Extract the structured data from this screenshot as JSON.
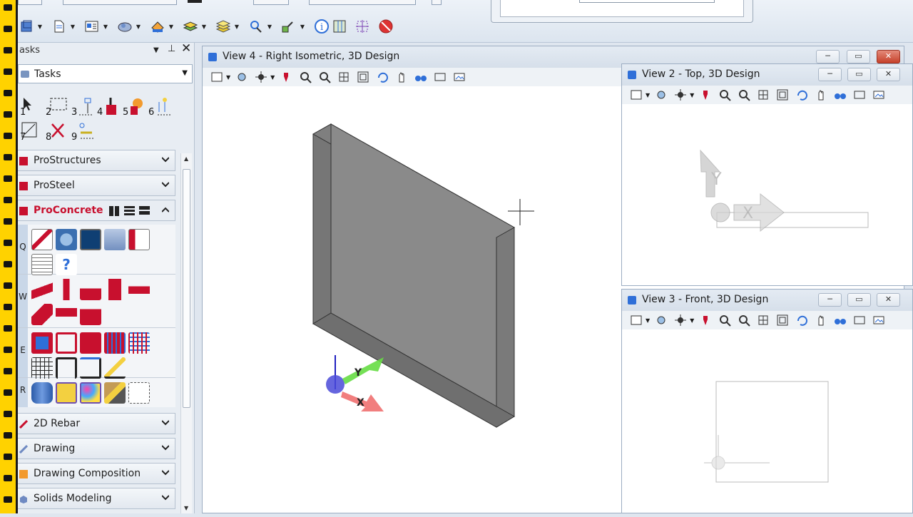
{
  "task_panel": {
    "title": "asks",
    "task_selector": "Tasks",
    "main_tool_numbers": [
      "1",
      "2",
      "3",
      "4",
      "5",
      "6",
      "7",
      "8",
      "9"
    ],
    "sections": [
      {
        "label": "ProStructures"
      },
      {
        "label": "ProSteel"
      },
      {
        "label": "ProConcrete"
      },
      {
        "label": "2D Rebar"
      },
      {
        "label": "Drawing"
      },
      {
        "label": "Drawing Composition"
      },
      {
        "label": "Solids Modeling"
      }
    ],
    "proconcrete_groups": [
      {
        "letter": "Q"
      },
      {
        "letter": "W"
      },
      {
        "letter": "E"
      },
      {
        "letter": "R"
      }
    ]
  },
  "views": {
    "view4": {
      "title": "View 4 - Right Isometric, 3D Design"
    },
    "view2": {
      "title": "View 2 - Top, 3D Design"
    },
    "view3": {
      "title": "View 3 - Front, 3D Design"
    }
  },
  "axis_labels": {
    "x": "X",
    "y": "Y"
  },
  "colors": {
    "accent_red": "#c8102e",
    "view_icon_blue": "#2f6fd8",
    "solid_fill": "#8a8a8a",
    "axis_x": "#f07070",
    "axis_y": "#7ad64a",
    "axis_z": "#4040d8"
  },
  "icons": {
    "toolbar": [
      "view-icon",
      "file-icon",
      "layout-icon",
      "cloud-icon",
      "fill-icon",
      "layers-icon",
      "stack-icon",
      "search-icon",
      "measure-icon",
      "info-icon",
      "grid-icon",
      "target-icon",
      "no-entry-icon"
    ],
    "view_toolbar": [
      "display-icon",
      "attribute-icon",
      "render-icon",
      "paint-icon",
      "zoom-in-icon",
      "zoom-out-icon",
      "fit-icon",
      "window-icon",
      "rotate-icon",
      "pan-icon",
      "glasses-icon",
      "view-frame-icon",
      "image-icon"
    ]
  }
}
